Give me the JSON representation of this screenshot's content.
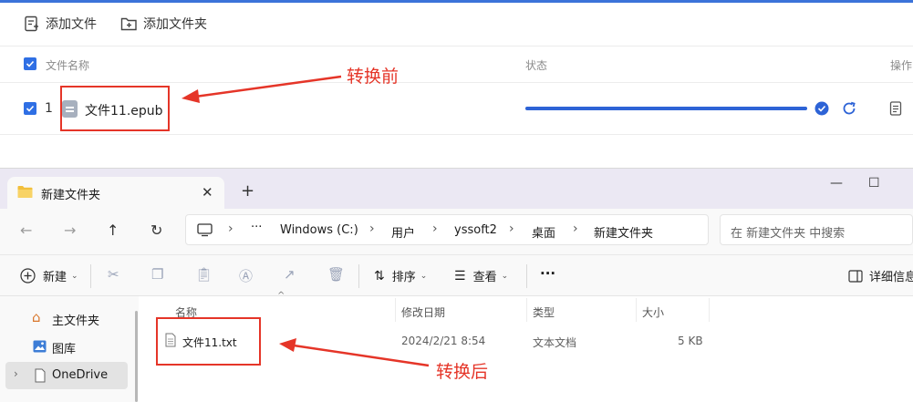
{
  "converter": {
    "toolbar": {
      "add_file": "添加文件",
      "add_folder": "添加文件夹"
    },
    "columns": {
      "file_name": "文件名称",
      "status": "状态",
      "actions": "操作"
    },
    "rows": [
      {
        "index": "1",
        "name": "文件11.epub",
        "progress": 1.0
      }
    ],
    "accent_color": "#2d63d6"
  },
  "annotations": {
    "before": "转换前",
    "after": "转换后",
    "color": "#e53528"
  },
  "explorer": {
    "tab_title": "新建文件夹",
    "breadcrumb": [
      "Windows (C:)",
      "用户",
      "yssoft2",
      "桌面",
      "新建文件夹"
    ],
    "search_placeholder": "在 新建文件夹 中搜索",
    "commands": {
      "new": "新建",
      "sort": "排序",
      "view": "查看",
      "more": "···",
      "details": "详细信息"
    },
    "sidebar": [
      {
        "label": "主文件夹",
        "icon": "home-icon"
      },
      {
        "label": "图库",
        "icon": "gallery-icon"
      },
      {
        "label": "OneDrive",
        "icon": "document-icon",
        "selected": true
      }
    ],
    "columns": {
      "name": "名称",
      "modified": "修改日期",
      "type": "类型",
      "size": "大小"
    },
    "files": [
      {
        "name": "文件11.txt",
        "modified": "2024/2/21 8:54",
        "type": "文本文档",
        "size": "5 KB"
      }
    ]
  }
}
